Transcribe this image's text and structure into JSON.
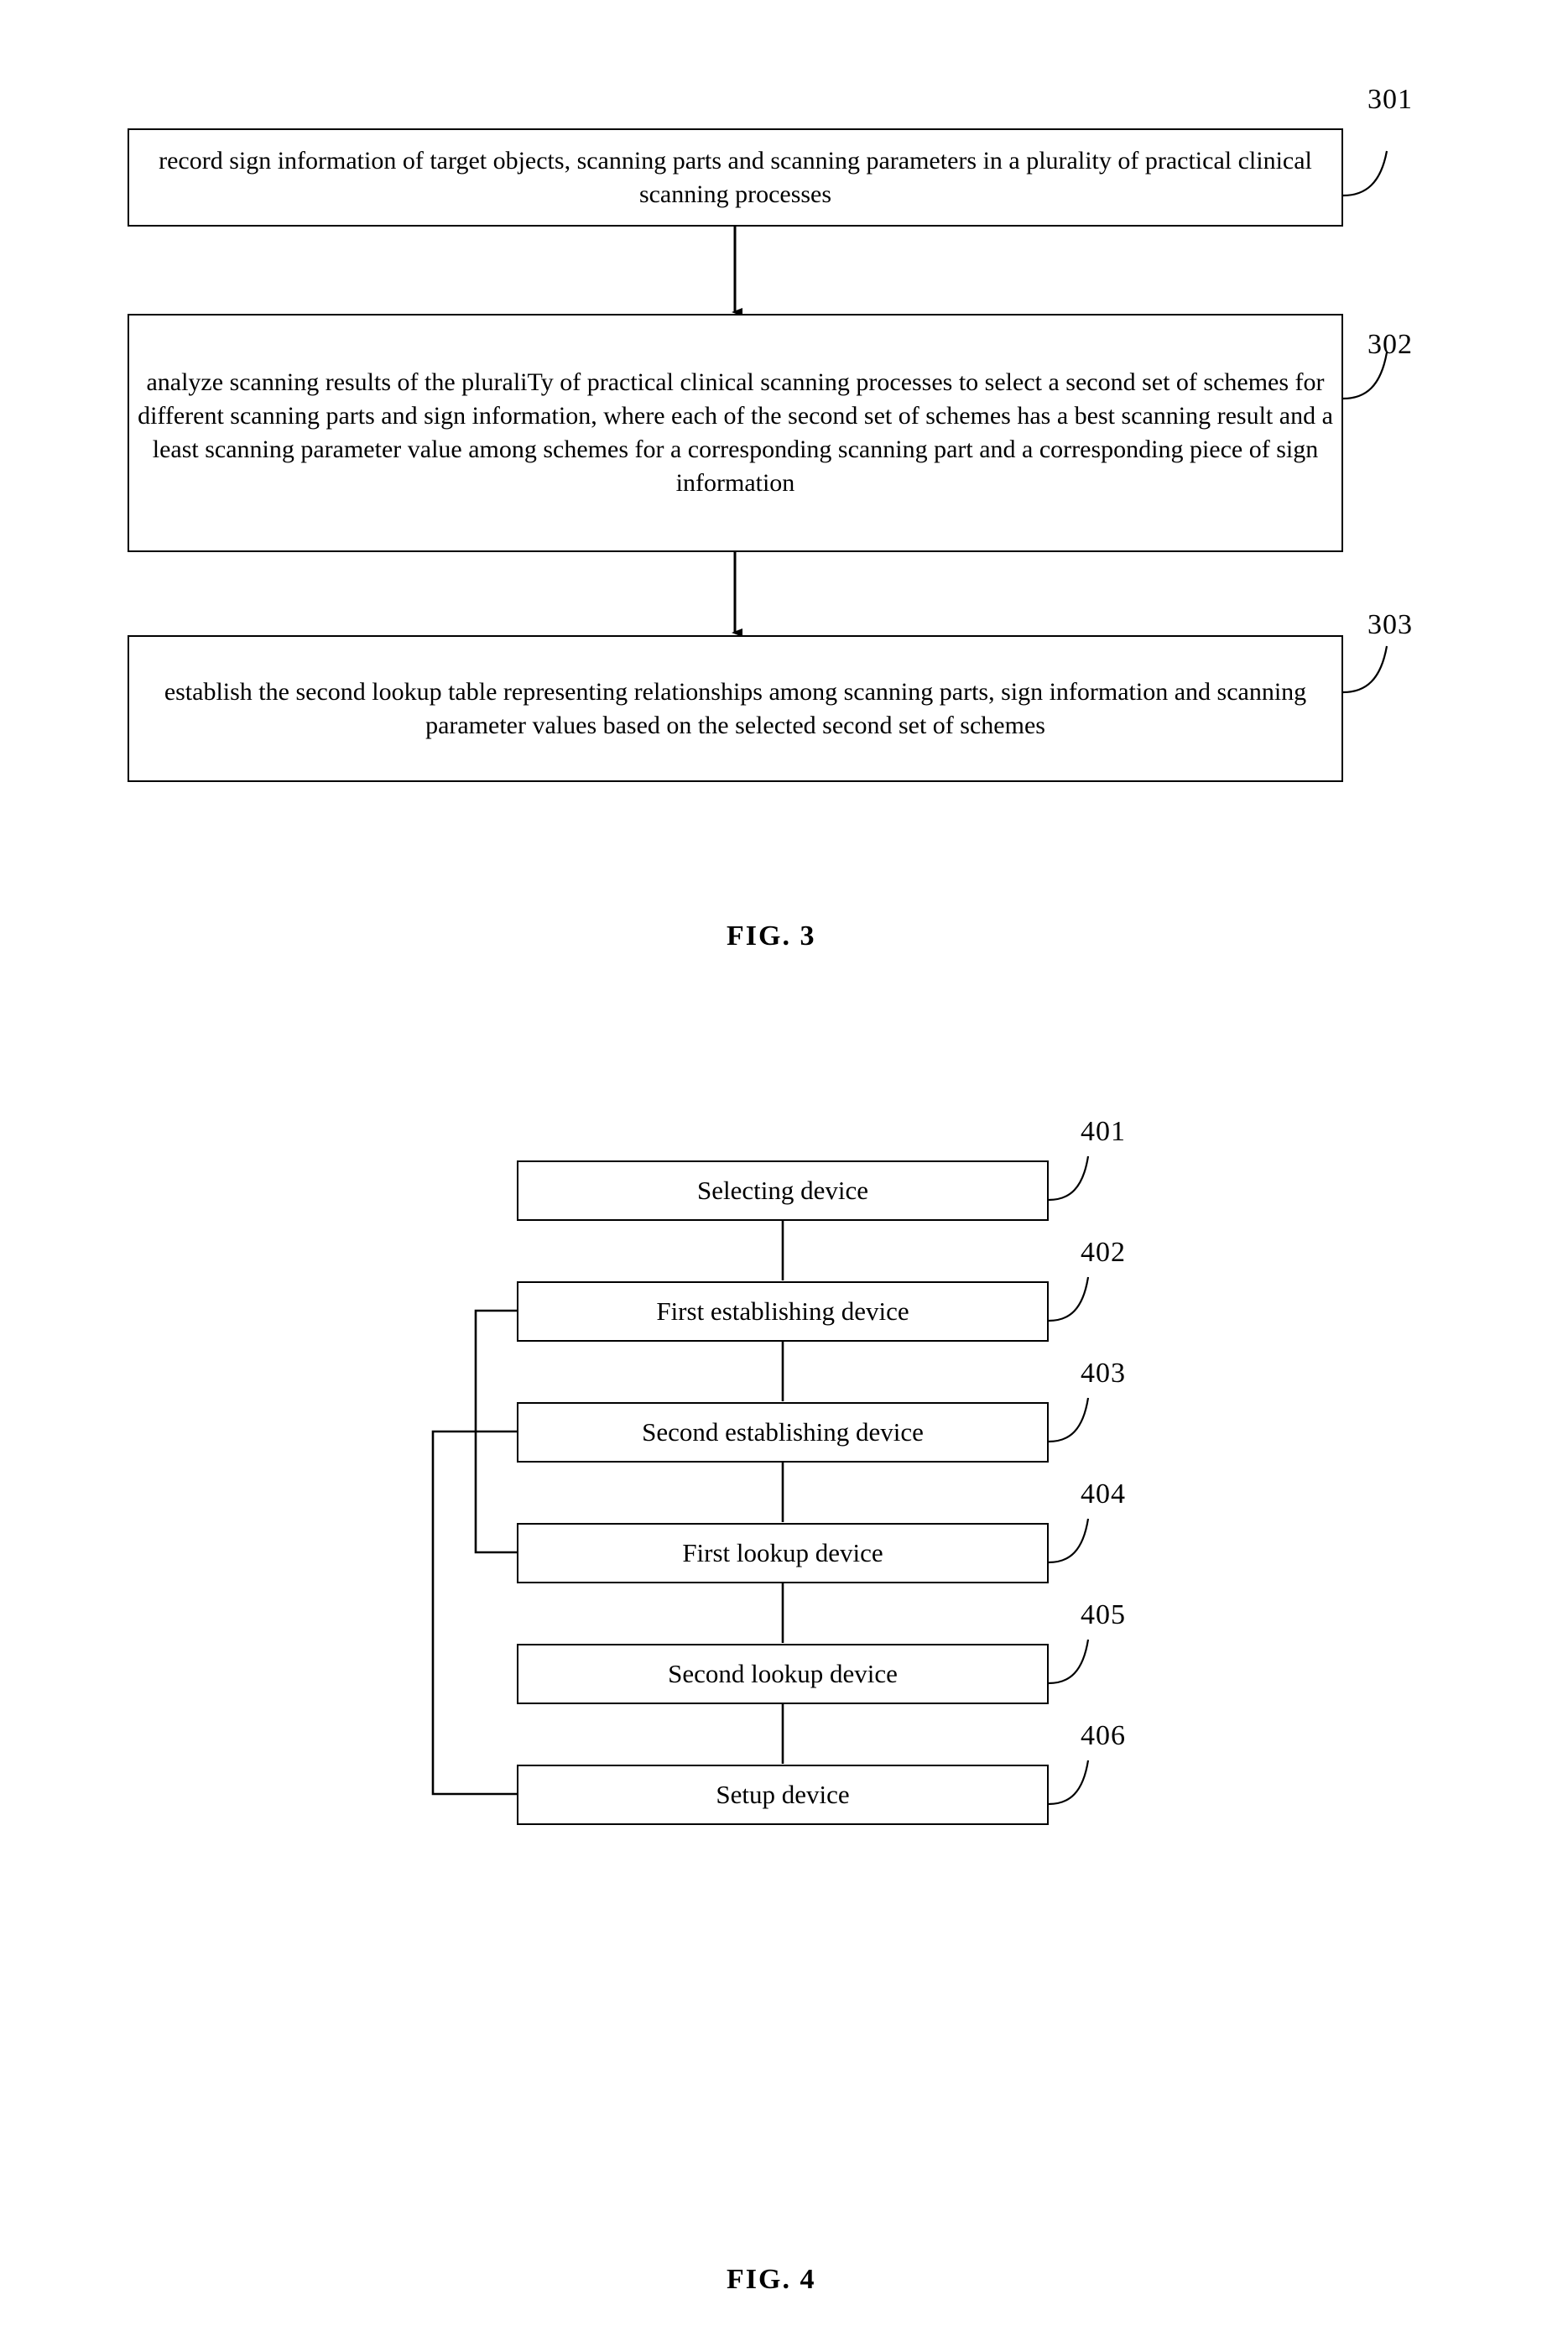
{
  "document": {
    "type": "patent-drawing-sheet",
    "figures": [
      {
        "id": "fig3",
        "label": "FIG. 3",
        "kind": "flowchart",
        "steps": [
          {
            "ref": "301",
            "text": "record sign information of target objects, scanning parts and scanning parameters in a plurality of practical clinical scanning processes"
          },
          {
            "ref": "302",
            "text": "analyze scanning results of the pluraliTy of practical clinical scanning processes to select a second set of schemes for different scanning parts and sign information, where each of the second set of schemes has a best scanning result and a least scanning parameter value among schemes for a corresponding scanning part and a corresponding piece of sign information"
          },
          {
            "ref": "303",
            "text": "establish the second lookup table representing relationships among scanning parts, sign information and scanning parameter values based on the selected second set of schemes"
          }
        ]
      },
      {
        "id": "fig4",
        "label": "FIG. 4",
        "kind": "block-diagram",
        "blocks": [
          {
            "ref": "401",
            "text": "Selecting device"
          },
          {
            "ref": "402",
            "text": "First establishing device"
          },
          {
            "ref": "403",
            "text": "Second establishing device"
          },
          {
            "ref": "404",
            "text": "First lookup device"
          },
          {
            "ref": "405",
            "text": "Second lookup device"
          },
          {
            "ref": "406",
            "text": "Setup device"
          }
        ]
      }
    ]
  },
  "colors": {
    "ink": "#000000",
    "paper": "#ffffff"
  }
}
